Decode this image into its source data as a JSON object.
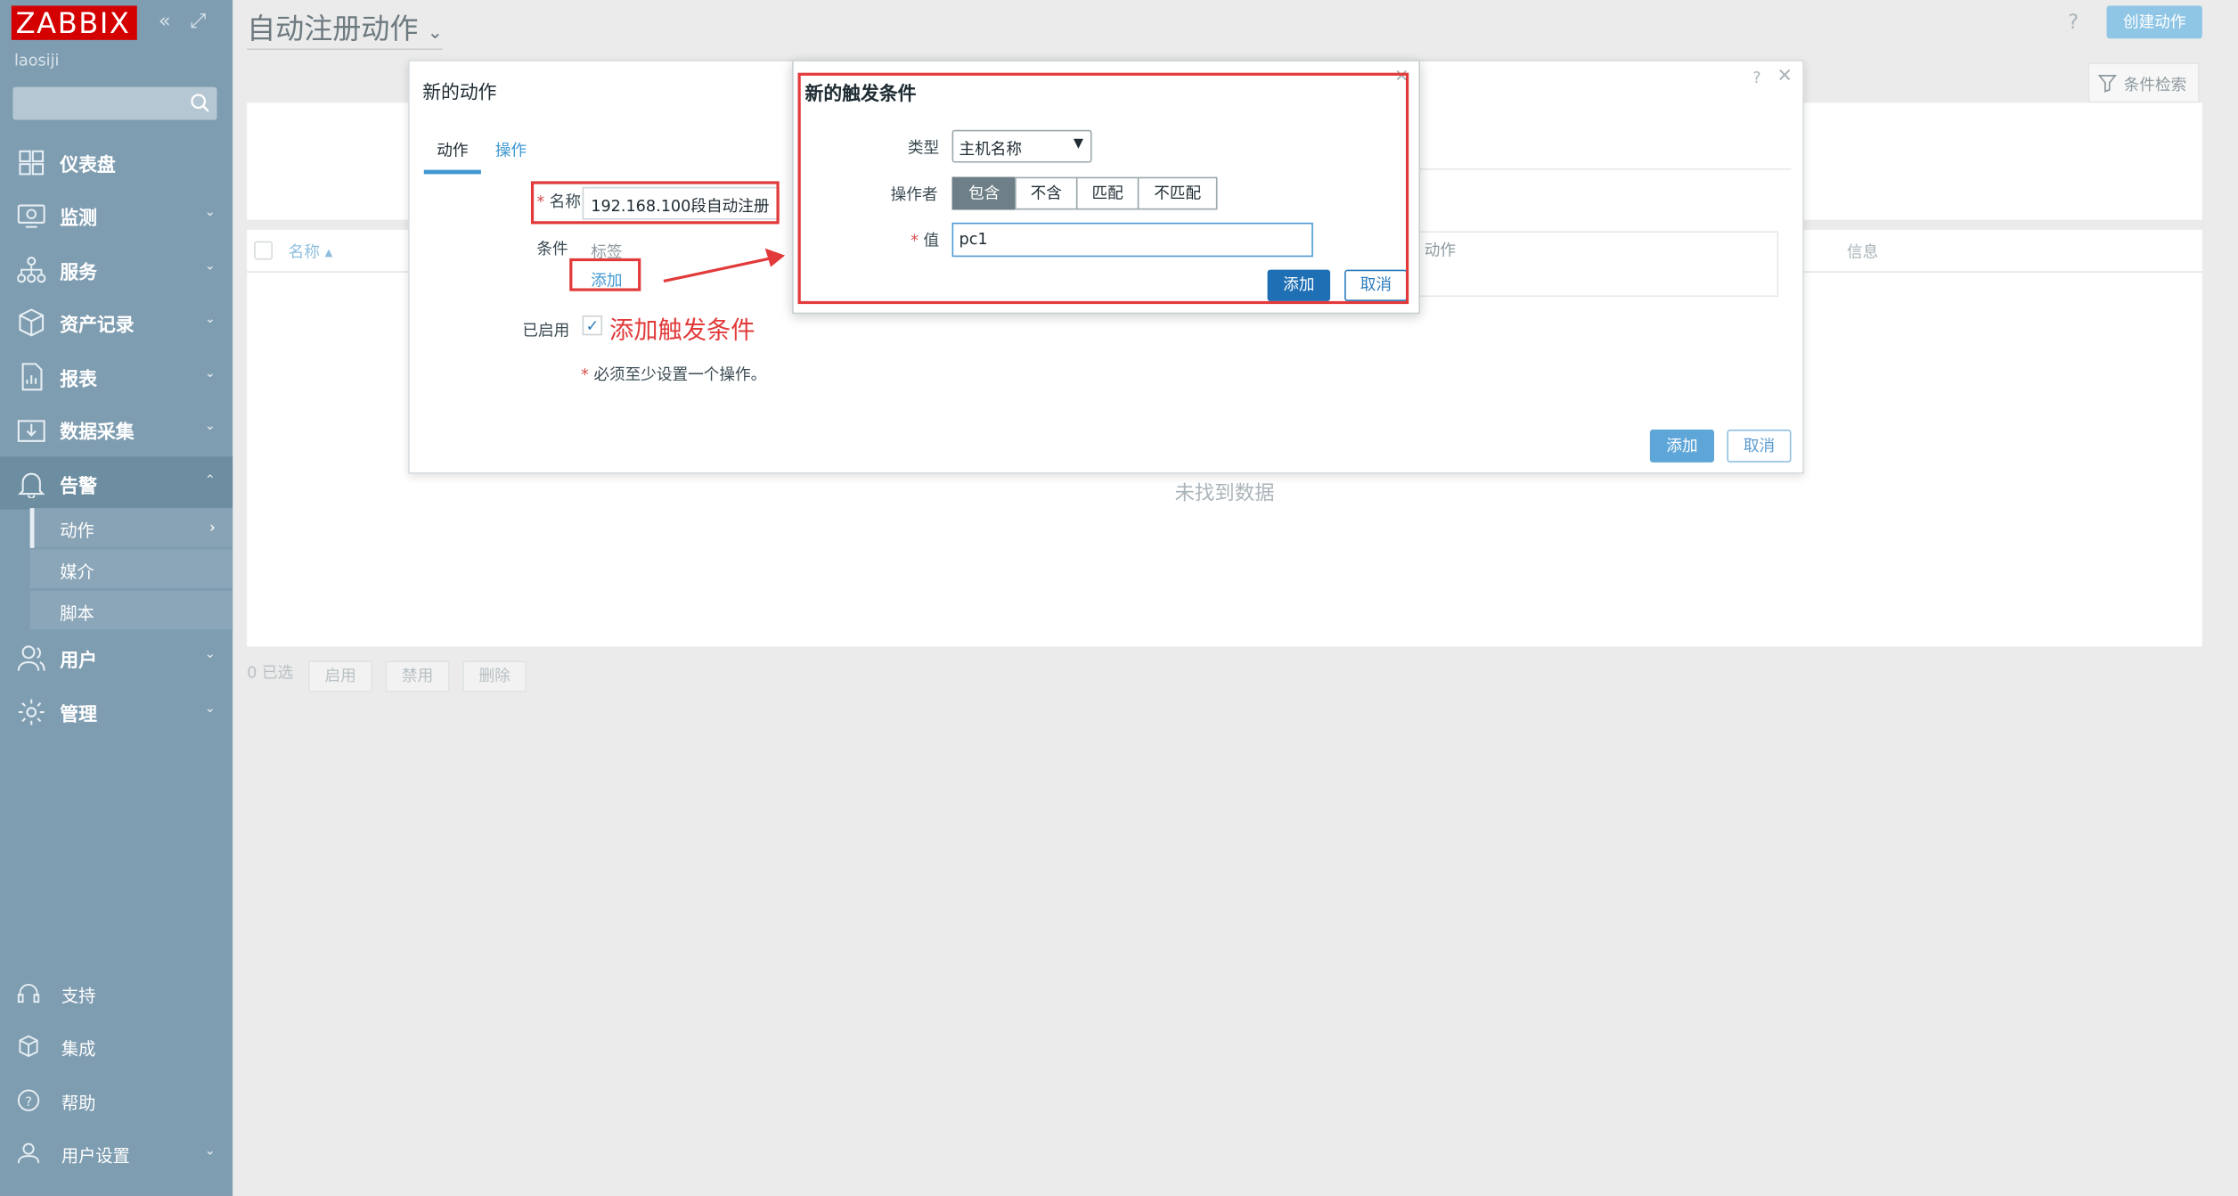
{
  "sidebar": {
    "logo": "ZABBIX",
    "username": "laosiji",
    "search_placeholder": "",
    "items": [
      {
        "label": "仪表盘"
      },
      {
        "label": "监测"
      },
      {
        "label": "服务"
      },
      {
        "label": "资产记录"
      },
      {
        "label": "报表"
      },
      {
        "label": "数据采集"
      },
      {
        "label": "告警"
      },
      {
        "label": "用户"
      },
      {
        "label": "管理"
      }
    ],
    "alert_sub": [
      {
        "label": "动作"
      },
      {
        "label": "媒介"
      },
      {
        "label": "脚本"
      }
    ],
    "bottom": [
      {
        "label": "支持"
      },
      {
        "label": "集成"
      },
      {
        "label": "帮助"
      },
      {
        "label": "用户设置"
      }
    ]
  },
  "header": {
    "title": "自动注册动作",
    "help": "?",
    "create_button": "创建动作",
    "filter_tab": "条件检索"
  },
  "list": {
    "col_name": "名称 ▴",
    "col_info": "信息",
    "no_data": "未找到数据",
    "selected": "0 已选",
    "btn_enable": "启用",
    "btn_disable": "禁用",
    "btn_delete": "删除"
  },
  "dialog": {
    "title": "新的动作",
    "help": "?",
    "close": "✕",
    "tab_action": "动作",
    "tab_operations": "操作",
    "name_label": "名称",
    "name_value": "192.168.100段自动注册",
    "conditions_label": "条件",
    "tag_label": "标签",
    "action_col_label": "动作",
    "add_link": "添加",
    "enabled_label": "已启用",
    "note": "必须至少设置一个操作。",
    "add_button": "添加",
    "cancel_button": "取消"
  },
  "condition_dialog": {
    "title": "新的触发条件",
    "close": "✕",
    "type_label": "类型",
    "type_value": "主机名称",
    "operator_label": "操作者",
    "operators": [
      "包含",
      "不含",
      "匹配",
      "不匹配"
    ],
    "selected_operator": "包含",
    "value_label": "值",
    "value": "pc1",
    "add_button": "添加",
    "cancel_button": "取消"
  },
  "annotation": {
    "text": "添加触发条件",
    "color": "#e23a3a"
  },
  "colors": {
    "sidebar": "#7f9db1",
    "accent": "#2a86c8",
    "brand_red": "#d40000"
  }
}
